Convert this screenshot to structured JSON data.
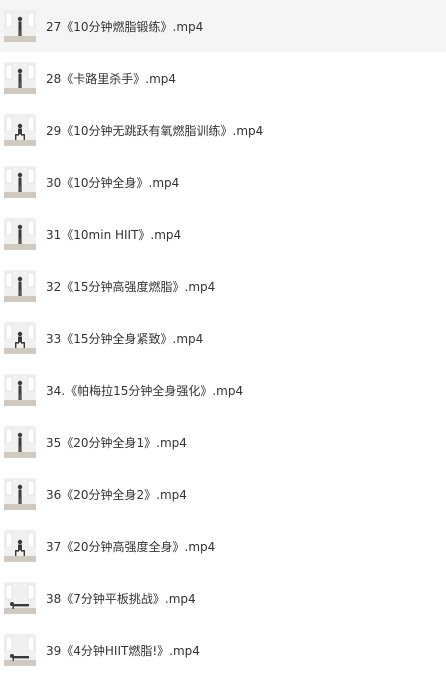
{
  "files": [
    {
      "name": "27《10分钟燃脂锻练》.mp4",
      "selected": true
    },
    {
      "name": "28《卡路里杀手》.mp4",
      "selected": false
    },
    {
      "name": "29《10分钟无跳跃有氧燃脂训练》.mp4",
      "selected": false
    },
    {
      "name": "30《10分钟全身》.mp4",
      "selected": false
    },
    {
      "name": "31《10min HIIT》.mp4",
      "selected": false
    },
    {
      "name": "32《15分钟高强度燃脂》.mp4",
      "selected": false
    },
    {
      "name": "33《15分钟全身紧致》.mp4",
      "selected": false
    },
    {
      "name": "34.《帕梅拉15分钟全身强化》.mp4",
      "selected": false
    },
    {
      "name": "35《20分钟全身1》.mp4",
      "selected": false
    },
    {
      "name": "36《20分钟全身2》.mp4",
      "selected": false
    },
    {
      "name": "37《20分钟高强度全身》.mp4",
      "selected": false
    },
    {
      "name": "38《7分钟平板挑战》.mp4",
      "selected": false
    },
    {
      "name": "39《4分钟HIIT燃脂!》.mp4",
      "selected": false
    }
  ],
  "colors": {
    "selected_row_bg": "#f5f5f5",
    "text": "#333333",
    "thumb_wall": "#f2f0ee",
    "thumb_floor": "#cfc9c2",
    "thumb_figure": "#3a3a3a"
  },
  "icons": {
    "thumbnail": "video-thumbnail-icon"
  }
}
